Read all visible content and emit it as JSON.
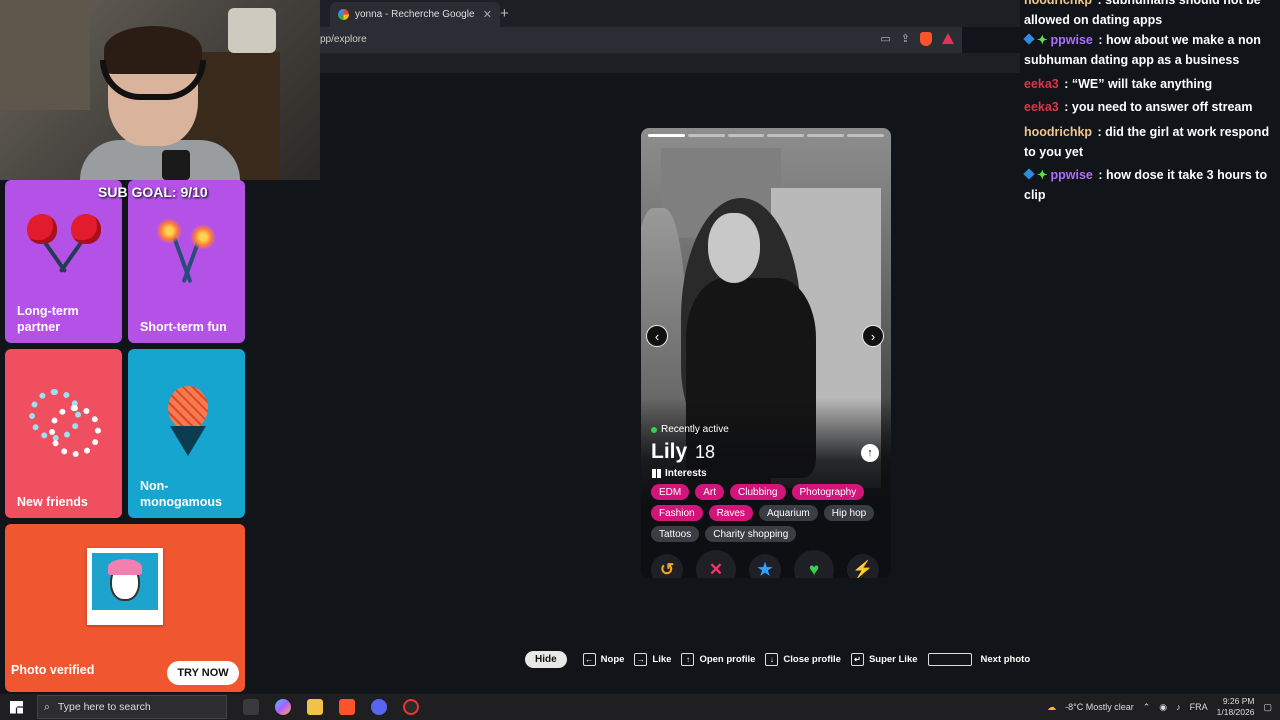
{
  "browser": {
    "tab_title": "yonna - Recherche Google",
    "tab_close": "✕",
    "new_tab": "+",
    "url": "pp/explore"
  },
  "overlay": {
    "sub_goal": "SUB GOAL: 9/10"
  },
  "purpose_cards": [
    {
      "label": "Long-term partner"
    },
    {
      "label": "Short-term fun"
    },
    {
      "label": "New friends"
    },
    {
      "label": "Non-monogamous"
    },
    {
      "label": "Photo verified",
      "button": "TRY NOW"
    }
  ],
  "profile": {
    "status": "Recently active",
    "name": "Lily",
    "age": "18",
    "interests_title": "Interests",
    "interests": [
      [
        "EDM",
        "Art",
        "Clubbing",
        "Photography"
      ],
      [
        "Fashion",
        "Raves",
        "Aquarium",
        "Hip hop"
      ],
      [
        "Tattoos",
        "Charity shopping"
      ]
    ],
    "interest_colors": {
      "shared": "#d1157a",
      "other": "#3a3d44"
    },
    "photo_count": 6,
    "active_photo": 1
  },
  "actions": {
    "rewind": "↺",
    "nope": "✕",
    "super_like": "★",
    "like": "♥",
    "boost": "⚡",
    "colors": {
      "rewind": "#f5a623",
      "nope": "#ff2d6f",
      "super_like": "#2fa4ff",
      "like": "#34d34a",
      "boost": "#b34dff"
    }
  },
  "hints": {
    "hide": "Hide",
    "items": [
      {
        "key": "←",
        "label": "Nope"
      },
      {
        "key": "→",
        "label": "Like"
      },
      {
        "key": "↑",
        "label": "Open profile"
      },
      {
        "key": "↓",
        "label": "Close profile"
      },
      {
        "key": "↵",
        "label": "Super Like"
      },
      {
        "key": "",
        "label": "Next photo"
      }
    ]
  },
  "chat": [
    {
      "user": "hoodrichkp",
      "color": "#f2c58a",
      "text": "subhumans should not be allowed on dating apps",
      "badges": false
    },
    {
      "user": "ppwise",
      "color": "#b06bff",
      "text": "how about we make a non subhuman dating app as a business",
      "badges": true
    },
    {
      "user": "eeka3",
      "color": "#e0334a",
      "text": "“WE” will take anything",
      "badges": false
    },
    {
      "user": "eeka3",
      "color": "#e0334a",
      "text": "you need to answer off stream",
      "badges": false
    },
    {
      "user": "hoodrichkp",
      "color": "#f2c58a",
      "text": "did the girl at work respond to you yet",
      "badges": false
    },
    {
      "user": "ppwise",
      "color": "#b06bff",
      "text": "how dose it take 3 hours to clip",
      "badges": true
    }
  ],
  "taskbar": {
    "search_placeholder": "Type here to search",
    "weather": "-8°C  Mostly clear",
    "lang": "FRA",
    "time": "9:26 PM",
    "date": "1/18/2026"
  }
}
